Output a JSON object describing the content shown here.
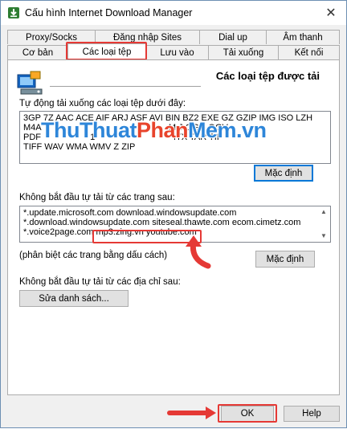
{
  "window": {
    "title": "Cấu hình Internet Download Manager",
    "close_glyph": "✕"
  },
  "tabs_top": [
    {
      "label": "Proxy/Socks"
    },
    {
      "label": "Đăng nhập Sites"
    },
    {
      "label": "Dial up"
    },
    {
      "label": "Âm thanh"
    }
  ],
  "tabs_bottom": [
    {
      "label": "Cơ bản"
    },
    {
      "label": "Các loại tệp",
      "active": true
    },
    {
      "label": "Lưu vào"
    },
    {
      "label": "Tải xuống"
    },
    {
      "label": "Kết nối"
    }
  ],
  "panel": {
    "title": "Các loại tệp được tải",
    "filetypes": {
      "label": "Tự động tải xuống các loại tệp dưới đây:",
      "lines": [
        "3GP 7Z AAC ACE AIF ARJ ASF AVI BIN BZ2 EXE GZ GZIP IMG ISO LZH",
        "M4A                                                    M J OGG OGV",
        "PDF                    1                                ITX TAR TIF",
        "TIFF WAV WMA WMV Z ZIP"
      ],
      "default_button": "Mặc định"
    },
    "watermark": {
      "part1": "Thu",
      "part2": "Thuat",
      "part3": "Phan",
      "part4": "Mem",
      "part5": ".vn"
    },
    "sites": {
      "label": "Không bắt đầu tự tải từ các trang sau:",
      "lines": [
        "*.update.microsoft.com download.windowsupdate.com",
        "*.download.windowsupdate.com siteseal.thawte.com ecom.cimetz.com",
        "*.voice2page.com mp3.zing.vn youtube.com"
      ],
      "hint": "(phân biệt các trang bằng dấu cách)",
      "default_button": "Mặc định"
    },
    "addresses": {
      "label": "Không bắt đầu tự tải từ các địa chỉ sau:",
      "edit_button": "Sửa danh sách..."
    }
  },
  "footer": {
    "ok": "OK",
    "help": "Help"
  },
  "colors": {
    "highlight": "#e53935",
    "watermark_blue": "#2e86d9",
    "watermark_red": "#e8442c"
  }
}
